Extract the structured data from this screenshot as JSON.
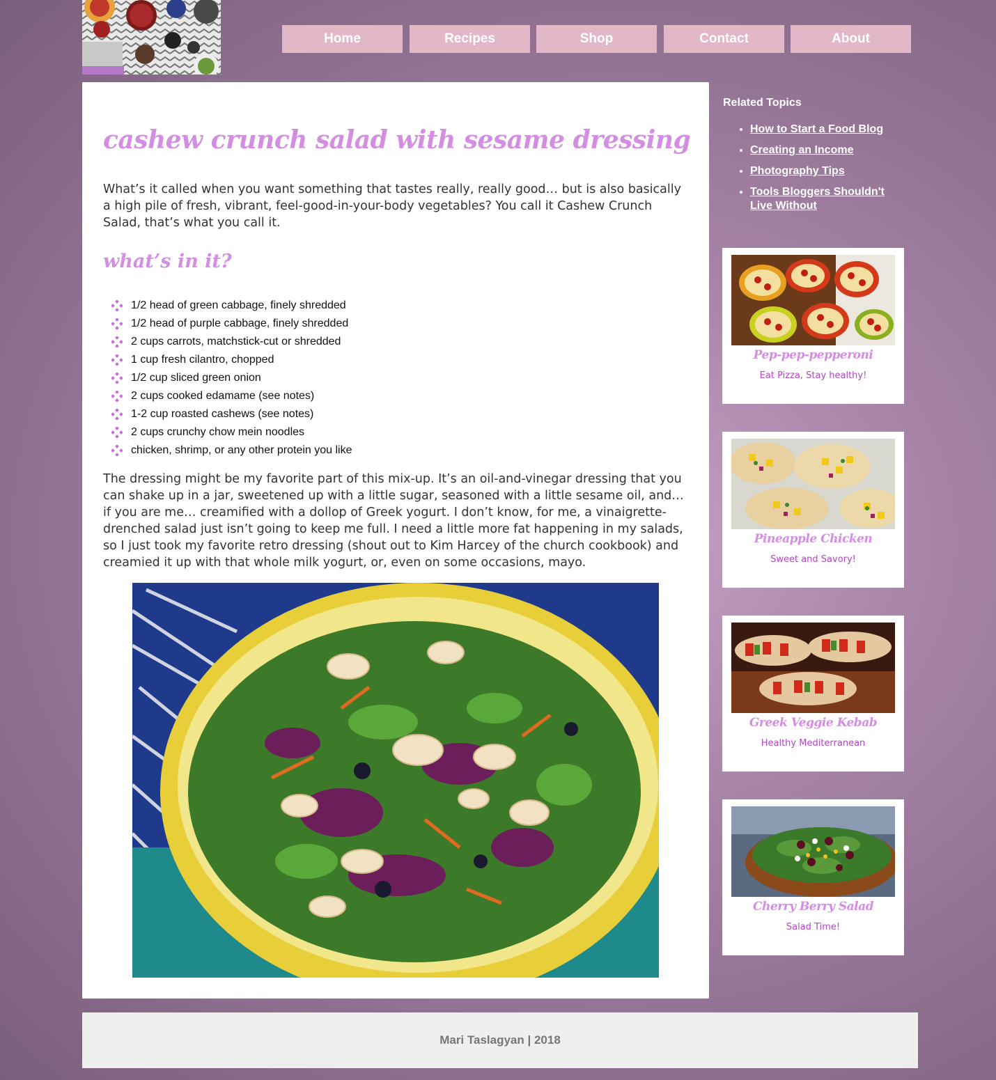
{
  "nav": {
    "items": [
      {
        "label": "Home"
      },
      {
        "label": "Recipes"
      },
      {
        "label": "Shop"
      },
      {
        "label": "Contact"
      },
      {
        "label": "About"
      }
    ]
  },
  "article": {
    "title": "cashew crunch salad with sesame dressing",
    "intro": "What’s it called when you want something that tastes really, really good… but is also basically a high pile of fresh, vibrant, feel-good-in-your-body vegetables? You call it Cashew Crunch Salad, that’s what you call it.",
    "subheading": "what’s in it?",
    "ingredients": [
      "1/2 head of green cabbage, finely shredded",
      "1/2 head of purple cabbage, finely shredded",
      "2 cups carrots, matchstick-cut or shredded",
      "1 cup fresh cilantro, chopped",
      "1/2 cup sliced green onion",
      "2 cups cooked edamame (see notes)",
      "1-2 cup roasted cashews (see notes)",
      "2 cups crunchy chow mein noodles",
      "chicken, shrimp, or any other protein you like"
    ],
    "dressing_paragraph": "The dressing might be my favorite part of this mix-up. It’s an oil-and-vinegar dressing that you can shake up in a jar, sweetened up with a little sugar, seasoned with a little sesame oil, and… if you are me… creamified with a dollop of Greek yogurt. I don’t know, for me, a vinaigrette-drenched salad just isn’t going to keep me full. I need a little more fat happening in my salads, so I just took my favorite retro dressing (shout out to Kim Harcey of the church cookbook) and creamied it up with that whole milk yogurt, or, even on some occasions, mayo."
  },
  "sidebar": {
    "related_title": "Related Topics",
    "related_links": [
      "How to Start a Food Blog",
      "Creating an Income",
      "Photography Tips",
      "Tools Bloggers Shouldn't Live Without"
    ],
    "cards": [
      {
        "title": "Pep-pep-pepperoni",
        "subtitle": "Eat Pizza, Stay healthy!"
      },
      {
        "title": "Pineapple Chicken",
        "subtitle": "Sweet and Savory!"
      },
      {
        "title": "Greek Veggie Kebab",
        "subtitle": "Healthy Mediterranean"
      },
      {
        "title": "Cherry Berry Salad",
        "subtitle": "Salad Time!"
      }
    ]
  },
  "footer": {
    "text": "Mari Taslagyan | 2018"
  },
  "colors": {
    "accent_pink": "#d38ee2",
    "nav_bg": "#e2b7c7",
    "card_subtitle": "#b246c4"
  }
}
